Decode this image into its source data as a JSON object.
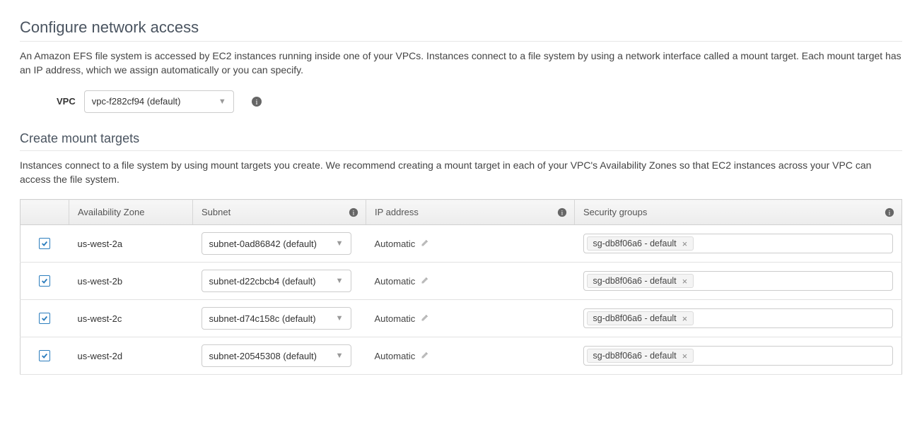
{
  "configure": {
    "title": "Configure network access",
    "description": "An Amazon EFS file system is accessed by EC2 instances running inside one of your VPCs. Instances connect to a file system by using a network interface called a mount target. Each mount target has an IP address, which we assign automatically or you can specify.",
    "vpc_label": "VPC",
    "vpc_value": "vpc-f282cf94 (default)"
  },
  "mount": {
    "title": "Create mount targets",
    "description": "Instances connect to a file system by using mount targets you create. We recommend creating a mount target in each of your VPC's Availability Zones so that EC2 instances across your VPC can access the file system."
  },
  "table": {
    "headers": {
      "az": "Availability Zone",
      "subnet": "Subnet",
      "ip": "IP address",
      "sg": "Security groups"
    },
    "ip_placeholder": "Automatic",
    "rows": [
      {
        "az": "us-west-2a",
        "subnet": "subnet-0ad86842 (default)",
        "sg": "sg-db8f06a6 - default"
      },
      {
        "az": "us-west-2b",
        "subnet": "subnet-d22cbcb4 (default)",
        "sg": "sg-db8f06a6 - default"
      },
      {
        "az": "us-west-2c",
        "subnet": "subnet-d74c158c (default)",
        "sg": "sg-db8f06a6 - default"
      },
      {
        "az": "us-west-2d",
        "subnet": "subnet-20545308 (default)",
        "sg": "sg-db8f06a6 - default"
      }
    ]
  }
}
